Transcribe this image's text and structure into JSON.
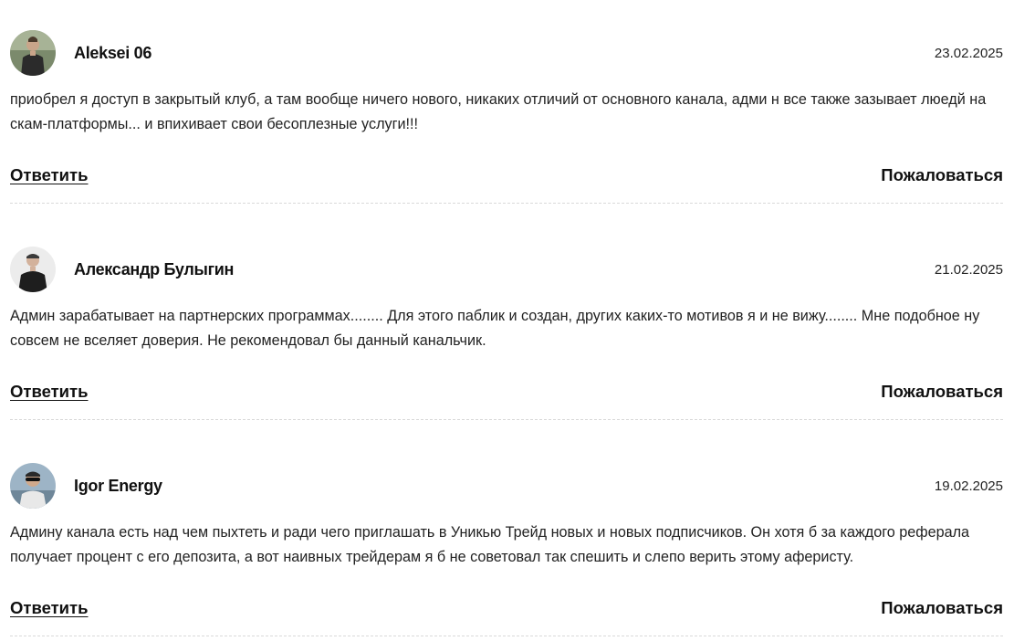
{
  "comments": [
    {
      "author": "Aleksei 06",
      "date": "23.02.2025",
      "text": "приобрел я доступ в закрытый клуб, а там вообще ничего нового, никаких отличий от основного канала, адми н все также зазывает люедй на скам-платформы... и впихивает свои бесоплезные услуги!!!",
      "reply_label": "Ответить",
      "report_label": "Пожаловаться"
    },
    {
      "author": "Александр Булыгин",
      "date": "21.02.2025",
      "text": "Админ зарабатывает на партнерских программах........ Для этого паблик и создан, других каких-то мотивов я и не вижу........ Мне подобное ну совсем не вселяет доверия. Не рекомендовал бы данный канальчик.",
      "reply_label": "Ответить",
      "report_label": "Пожаловаться"
    },
    {
      "author": "Igor Energy",
      "date": "19.02.2025",
      "text": "Админу канала есть над чем пыхтеть и ради чего приглашать в Уникью Трейд новых и новых подписчиков. Он хотя б за каждого реферала получает процент с его депозита, а вот наивных трейдерам я б не советовал так спешить и слепо верить этому аферисту.",
      "reply_label": "Ответить",
      "report_label": "Пожаловаться"
    }
  ]
}
